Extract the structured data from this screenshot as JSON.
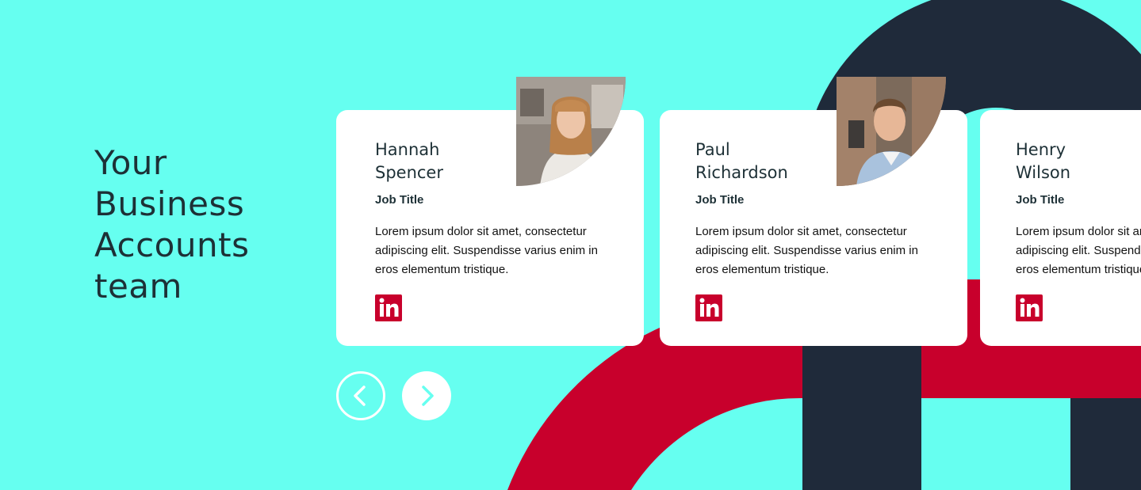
{
  "colors": {
    "background": "#66fff0",
    "navy": "#1f2a3a",
    "red": "#c8002c",
    "card": "#ffffff",
    "text_dark": "#1d3036"
  },
  "heading": {
    "lines": [
      "Your",
      "Business",
      "Accounts",
      "team"
    ]
  },
  "members": [
    {
      "first_name": "Hannah",
      "last_name": "Spencer",
      "job_title": "Job Title",
      "bio": "Lorem ipsum dolor sit amet, consectetur adipiscing elit. Suspendisse varius enim in eros elementum tristique.",
      "social_icon": "linkedin-icon"
    },
    {
      "first_name": "Paul",
      "last_name": "Richardson",
      "job_title": "Job Title",
      "bio": "Lorem ipsum dolor sit amet, consectetur adipiscing elit. Suspendisse varius enim in eros elementum tristique.",
      "social_icon": "linkedin-icon"
    },
    {
      "first_name": "Henry",
      "last_name": "Wilson",
      "job_title": "Job Title",
      "bio": "Lorem ipsum dolor sit amet, consectetur adipiscing elit. Suspendisse varius enim in eros elementum tristique.",
      "social_icon": "linkedin-icon"
    }
  ],
  "carousel": {
    "prev_icon": "chevron-left-icon",
    "next_icon": "chevron-right-icon"
  }
}
